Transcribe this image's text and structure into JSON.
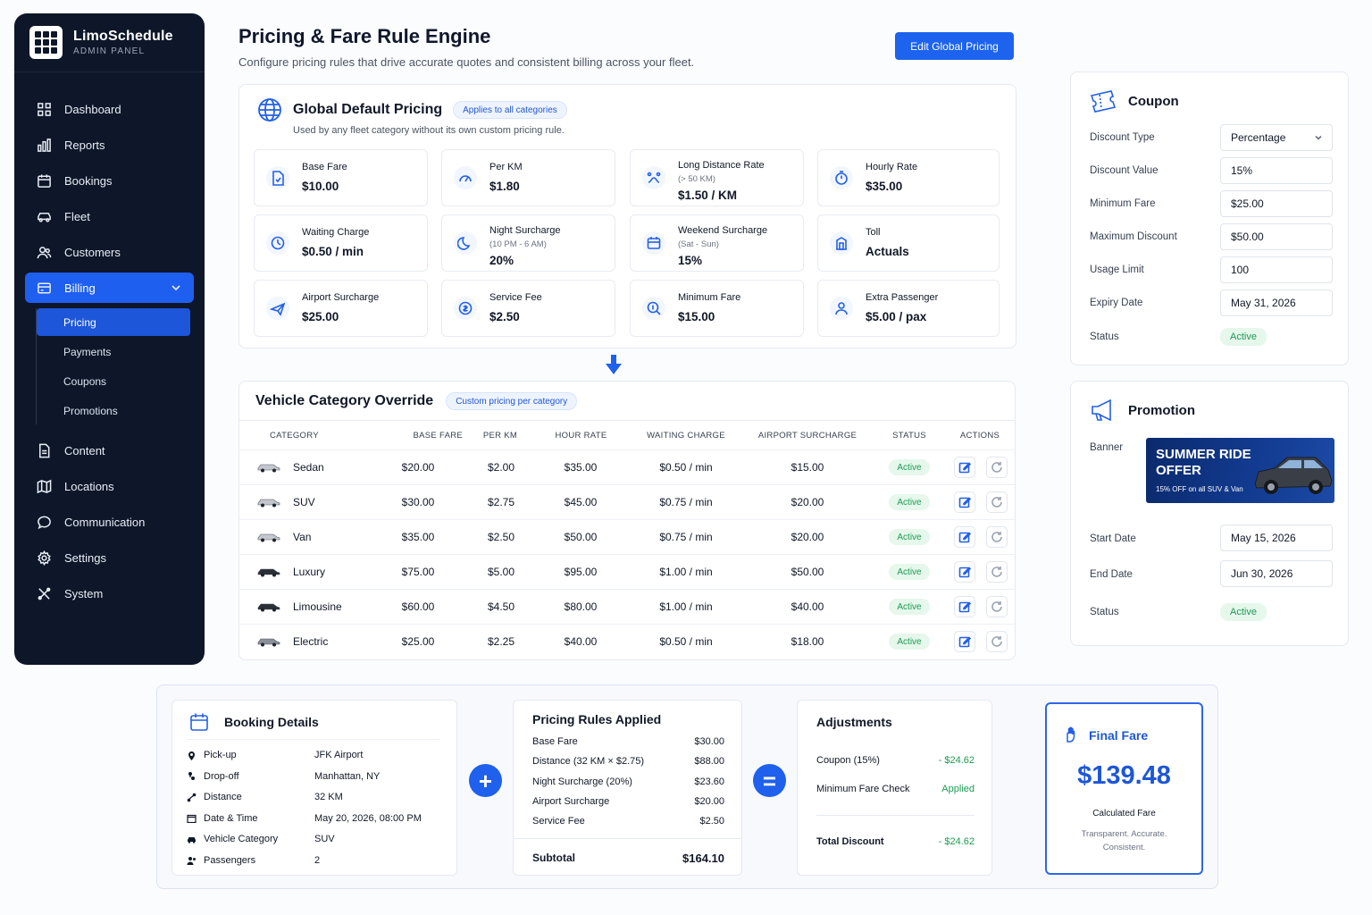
{
  "app": {
    "name": "LimoSchedule",
    "subtitle": "ADMIN PANEL"
  },
  "nav": {
    "items": [
      {
        "label": "Dashboard",
        "icon": "grid-icon"
      },
      {
        "label": "Reports",
        "icon": "bar-chart-icon"
      },
      {
        "label": "Bookings",
        "icon": "calendar-icon"
      },
      {
        "label": "Fleet",
        "icon": "car-icon"
      },
      {
        "label": "Customers",
        "icon": "users-icon"
      },
      {
        "label": "Billing",
        "icon": "billing-icon"
      }
    ],
    "billing_sub": [
      "Pricing",
      "Payments",
      "Coupons",
      "Promotions"
    ],
    "items_after": [
      {
        "label": "Content",
        "icon": "document-icon"
      },
      {
        "label": "Locations",
        "icon": "map-icon"
      },
      {
        "label": "Communication",
        "icon": "chat-icon"
      },
      {
        "label": "Settings",
        "icon": "gear-icon"
      },
      {
        "label": "System",
        "icon": "tools-icon"
      }
    ]
  },
  "header": {
    "title": "Pricing & Fare Rule Engine",
    "subtitle": "Configure pricing rules that drive accurate quotes and consistent billing across your fleet.",
    "edit_button": "Edit Global Pricing"
  },
  "global": {
    "title": "Global Default Pricing",
    "badge": "Applies to all categories",
    "desc": "Used by any fleet category without its own custom pricing rule.",
    "tiles": [
      {
        "label": "Base Fare",
        "note": "",
        "value": "$10.00"
      },
      {
        "label": "Per KM",
        "note": "",
        "value": "$1.80"
      },
      {
        "label": "Long Distance Rate",
        "note": "(> 50 KM)",
        "value": "$1.50 / KM"
      },
      {
        "label": "Hourly Rate",
        "note": "",
        "value": "$35.00"
      },
      {
        "label": "Waiting Charge",
        "note": "",
        "value": "$0.50 / min"
      },
      {
        "label": "Night Surcharge",
        "note": "(10 PM - 6 AM)",
        "value": "20%"
      },
      {
        "label": "Weekend Surcharge",
        "note": "(Sat - Sun)",
        "value": "15%"
      },
      {
        "label": "Toll",
        "note": "",
        "value": "Actuals"
      },
      {
        "label": "Airport Surcharge",
        "note": "",
        "value": "$25.00"
      },
      {
        "label": "Service Fee",
        "note": "",
        "value": "$2.50"
      },
      {
        "label": "Minimum Fare",
        "note": "",
        "value": "$15.00"
      },
      {
        "label": "Extra Passenger",
        "note": "",
        "value": "$5.00 / pax"
      }
    ]
  },
  "override": {
    "title": "Vehicle Category Override",
    "badge": "Custom pricing per category",
    "columns": [
      "CATEGORY",
      "BASE FARE",
      "PER KM",
      "HOUR RATE",
      "WAITING CHARGE",
      "AIRPORT SURCHARGE",
      "STATUS",
      "ACTIONS"
    ],
    "rows": [
      {
        "category": "Sedan",
        "base": "$20.00",
        "per_km": "$2.00",
        "hour": "$35.00",
        "waiting": "$0.50 / min",
        "airport": "$15.00",
        "status": "Active",
        "car_color": "#c4c8ce"
      },
      {
        "category": "SUV",
        "base": "$30.00",
        "per_km": "$2.75",
        "hour": "$45.00",
        "waiting": "$0.75 / min",
        "airport": "$20.00",
        "status": "Active",
        "car_color": "#c4c8ce"
      },
      {
        "category": "Van",
        "base": "$35.00",
        "per_km": "$2.50",
        "hour": "$50.00",
        "waiting": "$0.75 / min",
        "airport": "$20.00",
        "status": "Active",
        "car_color": "#c4c8ce"
      },
      {
        "category": "Luxury",
        "base": "$75.00",
        "per_km": "$5.00",
        "hour": "$95.00",
        "waiting": "$1.00 / min",
        "airport": "$50.00",
        "status": "Active",
        "car_color": "#2b2f36"
      },
      {
        "category": "Limousine",
        "base": "$60.00",
        "per_km": "$4.50",
        "hour": "$80.00",
        "waiting": "$1.00 / min",
        "airport": "$40.00",
        "status": "Active",
        "car_color": "#2b2f36"
      },
      {
        "category": "Electric",
        "base": "$25.00",
        "per_km": "$2.25",
        "hour": "$40.00",
        "waiting": "$0.50 / min",
        "airport": "$18.00",
        "status": "Active",
        "car_color": "#8a9099"
      }
    ]
  },
  "coupon": {
    "title": "Coupon",
    "fields": [
      {
        "label": "Discount Type",
        "value": "Percentage"
      },
      {
        "label": "Discount Value",
        "value": "15%"
      },
      {
        "label": "Minimum Fare",
        "value": "$25.00"
      },
      {
        "label": "Maximum Discount",
        "value": "$50.00"
      },
      {
        "label": "Usage Limit",
        "value": "100"
      },
      {
        "label": "Expiry Date",
        "value": "May 31, 2026"
      }
    ],
    "status_label": "Status",
    "status": "Active"
  },
  "promotion": {
    "title": "Promotion",
    "banner_label": "Banner",
    "banner_title": "SUMMER RIDE OFFER",
    "banner_sub": "15% OFF on all SUV & Van",
    "start_label": "Start Date",
    "start": "May 15, 2026",
    "end_label": "End Date",
    "end": "Jun 30, 2026",
    "status_label": "Status",
    "status": "Active"
  },
  "booking": {
    "title": "Booking Details",
    "rows": [
      {
        "label": "Pick-up",
        "value": "JFK Airport",
        "icon": "pin-icon"
      },
      {
        "label": "Drop-off",
        "value": "Manhattan, NY",
        "icon": "flag-icon"
      },
      {
        "label": "Distance",
        "value": "32 KM",
        "icon": "route-icon"
      },
      {
        "label": "Date & Time",
        "value": "May 20, 2026, 08:00 PM",
        "icon": "calendar-icon"
      },
      {
        "label": "Vehicle Category",
        "value": "SUV",
        "icon": "car-icon"
      },
      {
        "label": "Passengers",
        "value": "2",
        "icon": "users-icon"
      }
    ]
  },
  "rules": {
    "title": "Pricing Rules Applied",
    "rows": [
      {
        "label": "Base Fare",
        "value": "$30.00"
      },
      {
        "label": "Distance (32 KM × $2.75)",
        "value": "$88.00"
      },
      {
        "label": "Night Surcharge (20%)",
        "value": "$23.60"
      },
      {
        "label": "Airport Surcharge",
        "value": "$20.00"
      },
      {
        "label": "Service Fee",
        "value": "$2.50"
      }
    ],
    "subtotal_label": "Subtotal",
    "subtotal": "$164.10"
  },
  "adjustments": {
    "title": "Adjustments",
    "coupon_label": "Coupon (15%)",
    "coupon_value": "- $24.62",
    "min_label": "Minimum Fare Check",
    "min_value": "Applied",
    "total_label": "Total Discount",
    "total_value": "- $24.62"
  },
  "final": {
    "title": "Final Fare",
    "amount": "$139.48",
    "caption": "Calculated Fare",
    "tagline": "Transparent. Accurate. Consistent."
  },
  "operators": {
    "plus": "+",
    "equals": "="
  },
  "colors": {
    "accent": "#1d63ee",
    "sidebar": "#0e1729",
    "success": "#1d9b52"
  }
}
